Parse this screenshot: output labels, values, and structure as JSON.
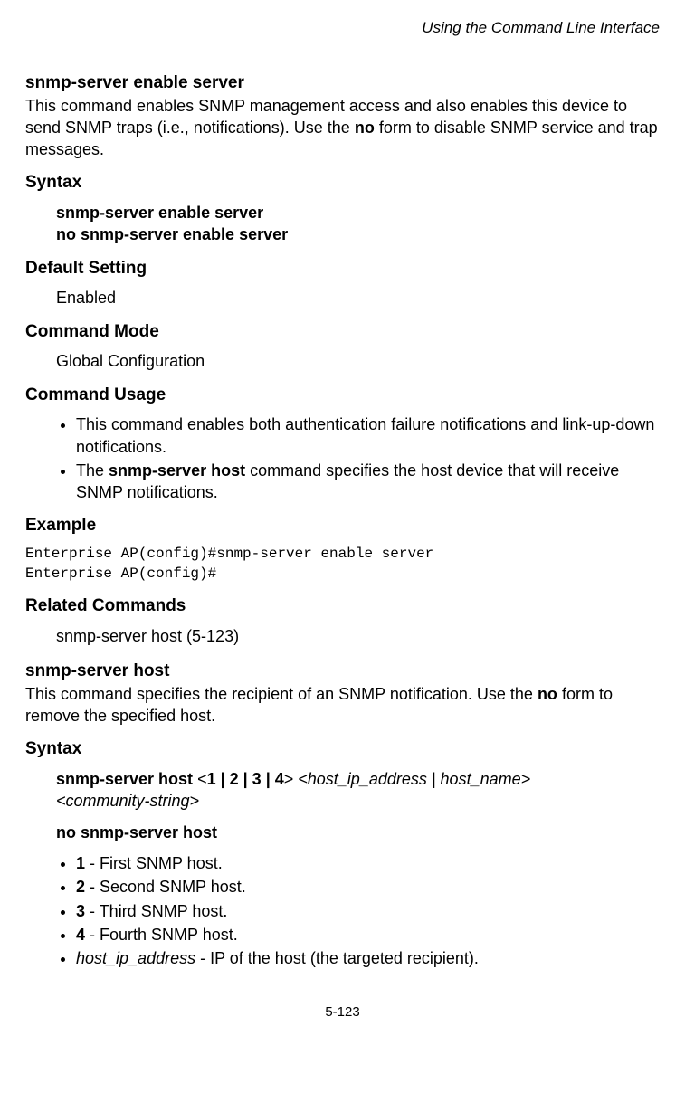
{
  "header": {
    "running_title": "Using the Command Line Interface"
  },
  "cmd1": {
    "title": "snmp-server enable server",
    "desc_pre": "This command enables SNMP management access and also enables this device to send SNMP traps (i.e., notifications). Use the ",
    "desc_bold": "no",
    "desc_post": " form to disable SNMP service and trap messages.",
    "syntax_head": "Syntax",
    "syntax_l1": "snmp-server enable server",
    "syntax_l2": "no snmp-server enable server",
    "default_head": "Default Setting",
    "default_val": "Enabled",
    "mode_head": "Command Mode",
    "mode_val": "Global Configuration",
    "usage_head": "Command Usage",
    "usage_li1": "This command enables both authentication failure notifications and link-up-down notifications.",
    "usage_li2_pre": "The ",
    "usage_li2_bold": "snmp-server host",
    "usage_li2_post": " command specifies the host device that will receive SNMP notifications.",
    "example_head": "Example",
    "example_code": "Enterprise AP(config)#snmp-server enable server\nEnterprise AP(config)#",
    "related_head": "Related Commands",
    "related_val": "snmp-server host (5-123)"
  },
  "cmd2": {
    "title": "snmp-server host",
    "desc_pre": "This command specifies the recipient of an SNMP notification. Use the ",
    "desc_bold": "no",
    "desc_post": " form to remove the specified host.",
    "syntax_head": "Syntax",
    "syntax_l1_b1": "snmp-server host",
    "syntax_l1_t1": " <",
    "syntax_l1_b2": "1 | 2 | 3 | 4",
    "syntax_l1_t2": "> ",
    "syntax_l1_i1": "<host_ip_address | host_name>",
    "syntax_l2_i": "<community-string>",
    "syntax_l3_b": "no snmp-server host",
    "li1_b": "1",
    "li1_t": " - First SNMP host.",
    "li2_b": "2",
    "li2_t": " - Second SNMP host.",
    "li3_b": "3",
    "li3_t": " - Third SNMP host.",
    "li4_b": "4",
    "li4_t": " - Fourth SNMP host.",
    "li5_i": "host_ip_address",
    "li5_t": " - IP of the host (the targeted recipient)."
  },
  "footer": {
    "page": "5-123"
  }
}
